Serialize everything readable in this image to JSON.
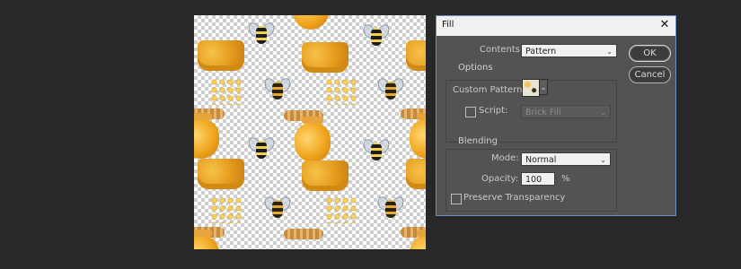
{
  "dialog": {
    "title": "Fill",
    "close_icon": "close-icon",
    "contents_label": "Contents:",
    "contents_value": "Pattern",
    "options": {
      "title": "Options",
      "custom_pattern_label": "Custom Pattern:",
      "script_label": "Script:",
      "script_value": "Brick Fill",
      "script_checked": false
    },
    "blending": {
      "title": "Blending",
      "mode_label": "Mode:",
      "mode_value": "Normal",
      "opacity_label": "Opacity:",
      "opacity_value": "100",
      "opacity_unit": "%",
      "preserve_label": "Preserve Transparency",
      "preserve_checked": false
    },
    "buttons": {
      "ok": "OK",
      "cancel": "Cancel"
    }
  },
  "canvas": {
    "pattern": "honey-bee-pattern"
  }
}
